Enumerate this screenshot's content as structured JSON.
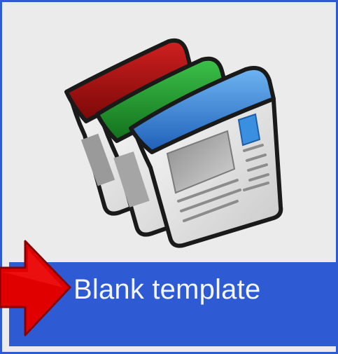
{
  "template_tile": {
    "label": "Blank template",
    "icon": "stacked-page-layouts-icon",
    "colors": {
      "tile_border": "#2f5bd1",
      "tile_background": "#ebebeb",
      "selection_band": "#2e5ad3",
      "label_text": "#f3f5ff",
      "pointer_arrow": "#e00000",
      "page_red": "#a80f0f",
      "page_green": "#1f9a2a",
      "page_blue": "#2f7fd6"
    }
  },
  "pointer": {
    "icon": "red-arrow-icon"
  }
}
